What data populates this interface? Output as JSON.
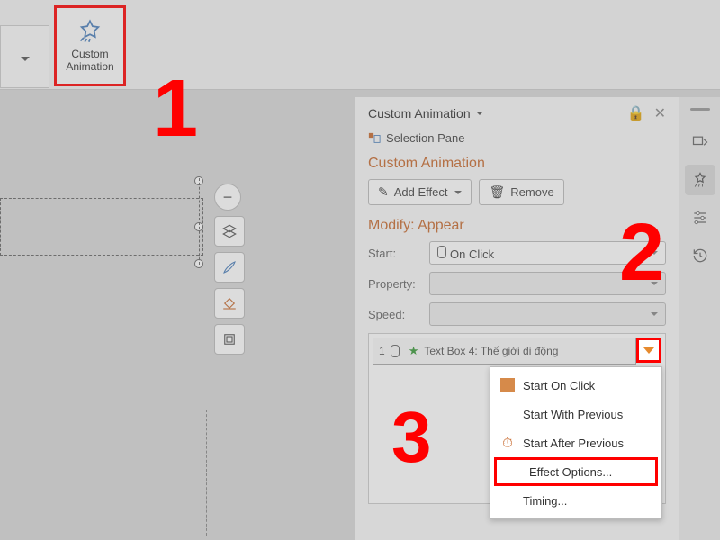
{
  "ribbon": {
    "custom_animation_label_l1": "Custom",
    "custom_animation_label_l2": "Animation"
  },
  "annotations": {
    "n1": "1",
    "n2": "2",
    "n3": "3"
  },
  "pane": {
    "title": "Custom Animation",
    "selection_pane": "Selection Pane",
    "section_title": "Custom Animation",
    "add_effect": "Add Effect",
    "remove": "Remove",
    "modify_title": "Modify: Appear",
    "start_label": "Start:",
    "start_value": "On Click",
    "property_label": "Property:",
    "speed_label": "Speed:",
    "list_item_order": "1",
    "list_item_text": "Text Box 4: Thế giới di động"
  },
  "menu": {
    "start_on_click": "Start On Click",
    "start_with_previous": "Start With Previous",
    "start_after_previous": "Start After Previous",
    "effect_options": "Effect Options...",
    "timing": "Timing..."
  }
}
